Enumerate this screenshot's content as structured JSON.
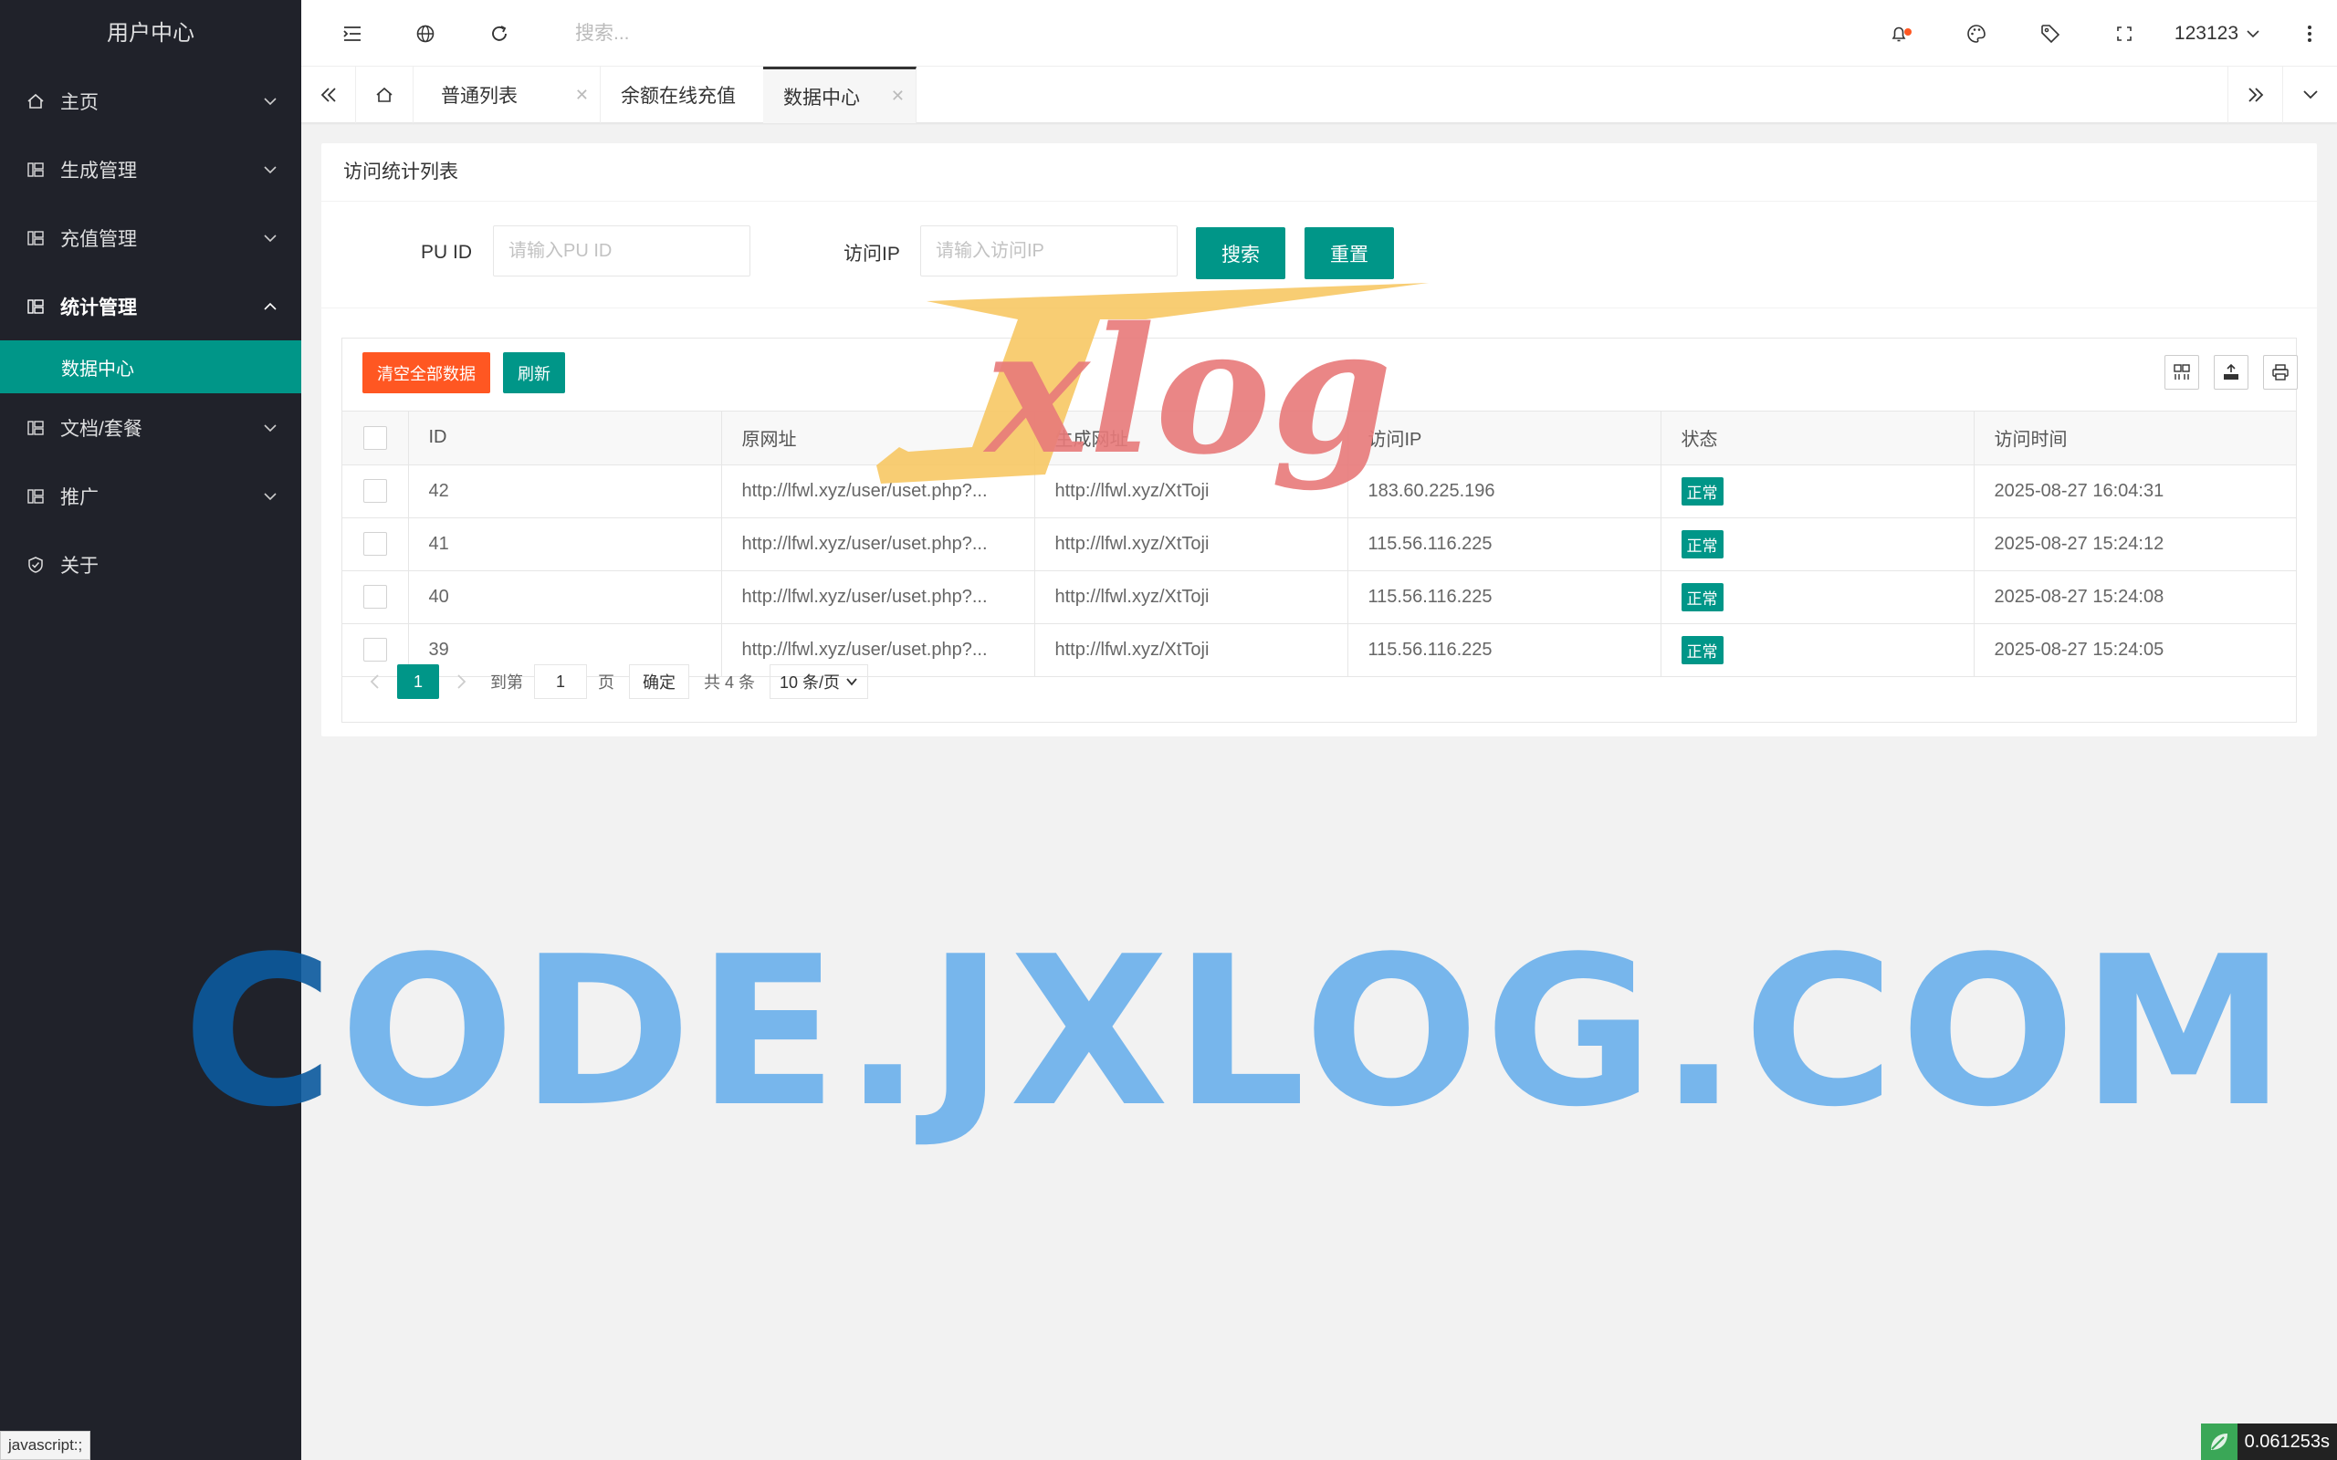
{
  "sidebar": {
    "title": "用户中心",
    "items": [
      {
        "label": "主页",
        "icon": "home-icon"
      },
      {
        "label": "生成管理",
        "icon": "grid-icon"
      },
      {
        "label": "充值管理",
        "icon": "grid-icon"
      },
      {
        "label": "统计管理",
        "icon": "grid-icon",
        "expanded": true
      },
      {
        "label": "文档/套餐",
        "icon": "grid-icon"
      },
      {
        "label": "推广",
        "icon": "grid-icon"
      },
      {
        "label": "关于",
        "icon": "shield-icon"
      }
    ],
    "sub_active": "数据中心"
  },
  "header": {
    "search_placeholder": "搜索...",
    "user": "123123"
  },
  "tabs": [
    {
      "label": "普通列表"
    },
    {
      "label": "余额在线充值"
    },
    {
      "label": "数据中心",
      "active": true
    }
  ],
  "card": {
    "title": "访问统计列表",
    "form": {
      "puid_label": "PU ID",
      "puid_placeholder": "请输入PU ID",
      "ip_label": "访问IP",
      "ip_placeholder": "请输入访问IP",
      "search_btn": "搜索",
      "reset_btn": "重置"
    },
    "toolbar": {
      "clear_btn": "清空全部数据",
      "refresh_btn": "刷新"
    },
    "table": {
      "headers": [
        "ID",
        "原网址",
        "生成网址",
        "访问IP",
        "状态",
        "访问时间"
      ],
      "rows": [
        [
          "42",
          "http://lfwl.xyz/user/uset.php?...",
          "http://lfwl.xyz/XtToji",
          "183.60.225.196",
          "正常",
          "2025-08-27 16:04:31"
        ],
        [
          "41",
          "http://lfwl.xyz/user/uset.php?...",
          "http://lfwl.xyz/XtToji",
          "115.56.116.225",
          "正常",
          "2025-08-27 15:24:12"
        ],
        [
          "40",
          "http://lfwl.xyz/user/uset.php?...",
          "http://lfwl.xyz/XtToji",
          "115.56.116.225",
          "正常",
          "2025-08-27 15:24:08"
        ],
        [
          "39",
          "http://lfwl.xyz/user/uset.php?...",
          "http://lfwl.xyz/XtToji",
          "115.56.116.225",
          "正常",
          "2025-08-27 15:24:05"
        ]
      ]
    },
    "pager": {
      "current": "1",
      "goto_label": "到第",
      "goto_value": "1",
      "page_unit": "页",
      "confirm": "确定",
      "total": "共 4 条",
      "page_size": "10 条/页"
    }
  },
  "watermark": {
    "logo_text": "Jxlog",
    "big_text_dark": "C",
    "big_text": "ODE.JXLOG.COM"
  },
  "status_bar": "javascript:;",
  "timer": "0.061253s",
  "colors": {
    "sidebar_bg": "#20222a",
    "accent": "#009688",
    "danger": "#ff5722"
  }
}
